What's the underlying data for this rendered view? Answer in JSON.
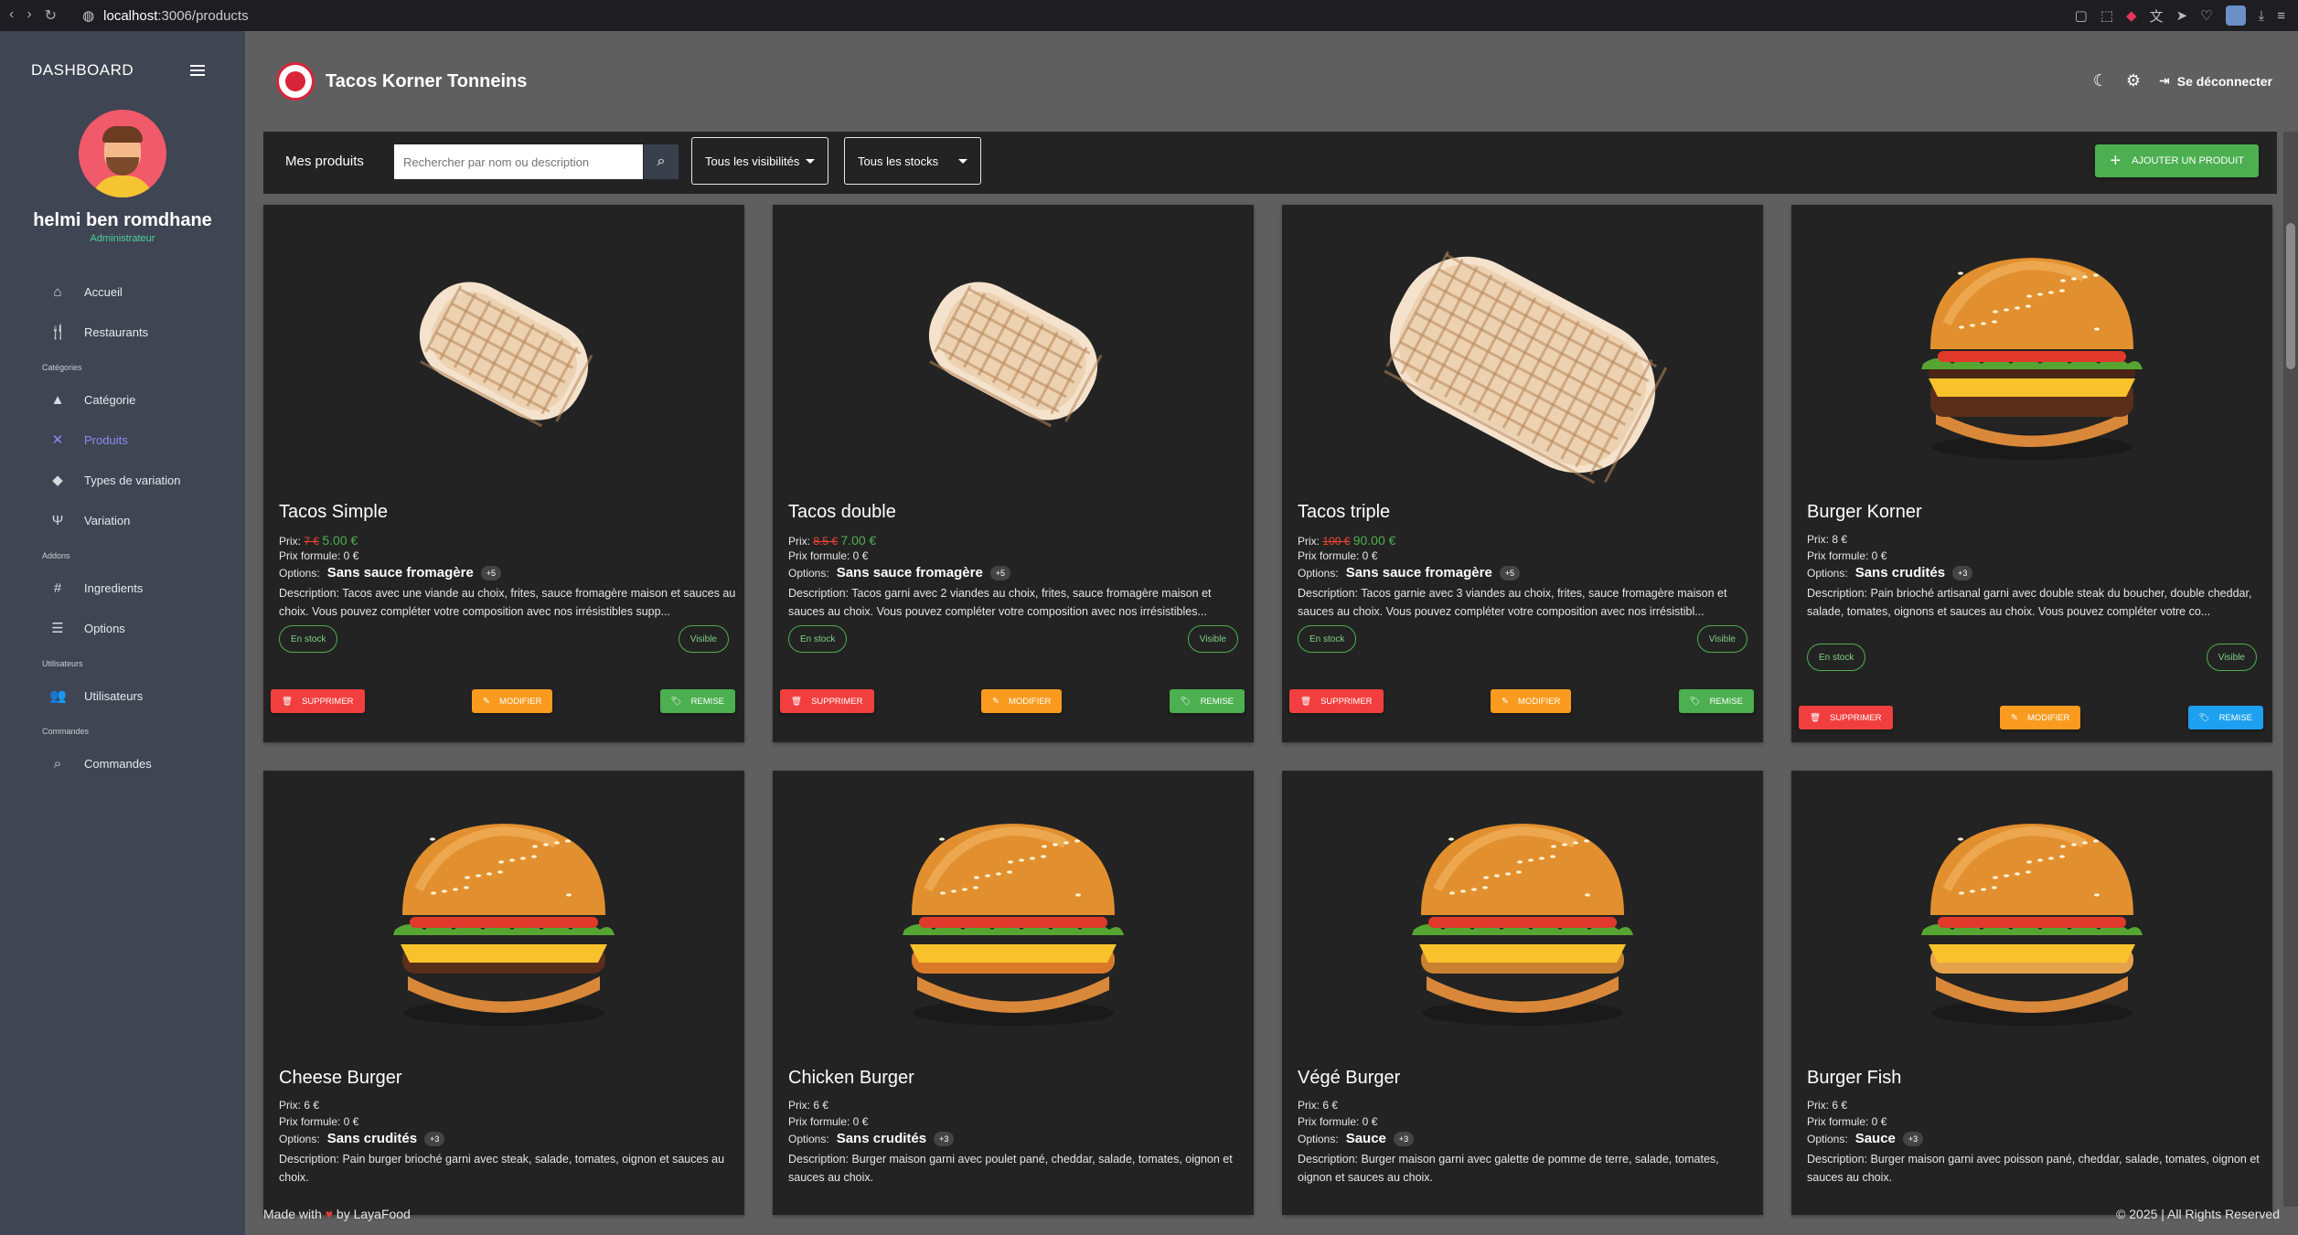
{
  "browser": {
    "url_host": "localhost",
    "url_path": ":3006/products"
  },
  "sidebar": {
    "title": "DASHBOARD",
    "user_name": "helmi ben romdhane",
    "user_role": "Administrateur",
    "items": [
      {
        "type": "item",
        "label": "Accueil",
        "icon": "home-icon",
        "glyph": "⌂"
      },
      {
        "type": "item",
        "label": "Restaurants",
        "icon": "fork-knife-icon",
        "glyph": "🍴"
      },
      {
        "type": "section",
        "label": "Catégories"
      },
      {
        "type": "item",
        "label": "Catégorie",
        "icon": "category-icon",
        "glyph": "▲"
      },
      {
        "type": "item",
        "label": "Produits",
        "icon": "utensils-cross-icon",
        "glyph": "✕",
        "active": true
      },
      {
        "type": "item",
        "label": "Types de variation",
        "icon": "variation-type-icon",
        "glyph": "◆"
      },
      {
        "type": "item",
        "label": "Variation",
        "icon": "fork-icon",
        "glyph": "Ψ"
      },
      {
        "type": "section",
        "label": "Addons"
      },
      {
        "type": "item",
        "label": "Ingredients",
        "icon": "ingredients-icon",
        "glyph": "#"
      },
      {
        "type": "item",
        "label": "Options",
        "icon": "options-checklist-icon",
        "glyph": "☰"
      },
      {
        "type": "section",
        "label": "Utilisateurs"
      },
      {
        "type": "item",
        "label": "Utilisateurs",
        "icon": "users-icon",
        "glyph": "👥"
      },
      {
        "type": "section",
        "label": "Commandes"
      },
      {
        "type": "item",
        "label": "Commandes",
        "icon": "orders-search-icon",
        "glyph": "⌕"
      }
    ]
  },
  "header": {
    "brand": "Tacos Korner Tonneins",
    "logout": "Se déconnecter"
  },
  "toolbar": {
    "title": "Mes produits",
    "search_placeholder": "Rechercher par nom ou description",
    "visibility_filter": "Tous les visibilités",
    "stock_filter": "Tous les stocks",
    "add_button": "AJOUTER UN PRODUIT"
  },
  "labels": {
    "price": "Prix:",
    "formula_price": "Prix formule: 0 €",
    "options": "Options:",
    "description": "Description:",
    "delete": "SUPPRIMER",
    "edit": "MODIFIER",
    "discount": "REMISE",
    "in_stock": "En stock",
    "visible": "Visible"
  },
  "products": [
    {
      "name": "Tacos Simple",
      "price_old": "7 €",
      "price_new": "5.00 €",
      "option": "Sans sauce fromagère",
      "more": "+5",
      "desc": "Description: Tacos avec une viande au choix, frites, sauce fromagère maison et sauces au choix. Vous pouvez compléter votre composition avec nos irrésistibles supp...",
      "kind": "tacos",
      "discount_color": "green"
    },
    {
      "name": "Tacos double",
      "price_old": "8.5 €",
      "price_new": "7.00 €",
      "option": "Sans sauce fromagère",
      "more": "+5",
      "desc": "Description: Tacos garni avec 2 viandes au choix, frites, sauce fromagère maison et sauces au choix. Vous pouvez compléter votre composition avec nos irrésistibles...",
      "kind": "tacos",
      "discount_color": "green"
    },
    {
      "name": "Tacos triple",
      "price_old": "100 €",
      "price_new": "90.00 €",
      "option": "Sans sauce fromagère",
      "more": "+5",
      "desc": "Description: Tacos garnie avec 3 viandes au choix, frites, sauce fromagère maison et sauces au choix. Vous pouvez compléter votre  composition avec nos irrésistibl...",
      "kind": "tacos-big",
      "discount_color": "green"
    },
    {
      "name": "Burger Korner",
      "price": "8 €",
      "option": "Sans crudités",
      "more": "+3",
      "desc": "Description: Pain brioché artisanal garni avec double steak du boucher, double cheddar, salade, tomates, oignons et sauces au choix. Vous pouvez compléter votre co...",
      "kind": "burger-double",
      "discount_color": "blue"
    },
    {
      "name": "Cheese Burger",
      "price": "6 €",
      "option": "Sans crudités",
      "more": "+3",
      "desc": "Description: Pain burger brioché garni avec steak, salade, tomates, oignon et sauces au choix.",
      "kind": "burger",
      "discount_color": "green"
    },
    {
      "name": "Chicken Burger",
      "price": "6 €",
      "option": "Sans crudités",
      "more": "+3",
      "desc": "Description: Burger maison garni avec poulet pané, cheddar, salade, tomates, oignon et sauces au choix.",
      "kind": "burger-chicken",
      "discount_color": "green"
    },
    {
      "name": "Végé Burger",
      "price": "6 €",
      "option": "Sauce",
      "more": "+3",
      "desc": "Description: Burger maison garni avec galette de pomme de terre, salade, tomates, oignon et sauces au choix.",
      "kind": "burger-vege",
      "discount_color": "green"
    },
    {
      "name": "Burger Fish",
      "price": "6 €",
      "option": "Sauce",
      "more": "+3",
      "desc": "Description: Burger maison garni avec poisson pané, cheddar, salade, tomates, oignon et sauces au choix.",
      "kind": "burger-fish",
      "discount_color": "green"
    }
  ],
  "footer": {
    "made_with": "Made with",
    "by": "by LayaFood",
    "copyright": "© 2025 | All Rights Reserved"
  },
  "colors": {
    "delete": "#f13f3f",
    "edit": "#fa9b1f",
    "discount_green": "#4caf50",
    "discount_blue": "#1da0ef",
    "accent": "#8a8cf5"
  }
}
